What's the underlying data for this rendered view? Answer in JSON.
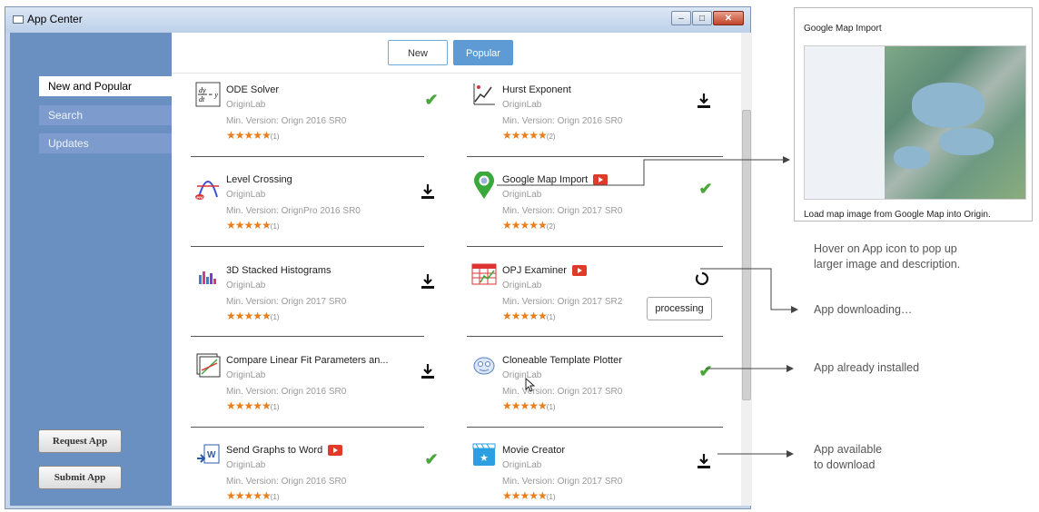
{
  "window": {
    "title": "App Center"
  },
  "sidebar": {
    "nav": [
      {
        "label": "New and Popular",
        "active": true
      },
      {
        "label": "Search",
        "active": false
      },
      {
        "label": "Updates",
        "active": false
      }
    ],
    "request_label": "Request App",
    "submit_label": "Submit App"
  },
  "tabs": {
    "new_label": "New",
    "popular_label": "Popular"
  },
  "apps": [
    {
      "name": "ODE Solver",
      "author": "OriginLab",
      "version": "Min. Version: Orign 2016 SR0",
      "stars": "★★★★★",
      "count": "(1)",
      "status": "installed",
      "icon": "ode-solver-icon"
    },
    {
      "name": "Hurst Exponent",
      "author": "OriginLab",
      "version": "Min. Version: Orign 2016 SR0",
      "stars": "★★★★★",
      "count": "(2)",
      "status": "download",
      "icon": "hurst-exponent-icon"
    },
    {
      "name": "Level Crossing",
      "author": "OriginLab",
      "version": "Min. Version: OrignPro 2016 SR0",
      "stars": "★★★★★",
      "count": "(1)",
      "status": "download",
      "icon": "level-crossing-icon"
    },
    {
      "name": "Google Map Import",
      "author": "OriginLab",
      "version": "Min. Version: Orign 2017 SR0",
      "stars": "★★★★★",
      "count": "(2)",
      "status": "installed",
      "icon": "map-pin-icon",
      "video": true
    },
    {
      "name": "3D Stacked Histograms",
      "author": "OriginLab",
      "version": "Min. Version: Orign 2017 SR0",
      "stars": "★★★★★",
      "count": "(1)",
      "status": "download",
      "icon": "histogram-icon"
    },
    {
      "name": "OPJ Examiner",
      "author": "OriginLab",
      "version": "Min. Version: Orign 2017 SR2",
      "stars": "★★★★★",
      "count": "(1)",
      "status": "processing",
      "icon": "spreadsheet-icon",
      "video": true
    },
    {
      "name": "Compare Linear Fit Parameters an...",
      "author": "OriginLab",
      "version": "Min. Version: Orign 2016 SR0",
      "stars": "★★★★★",
      "count": "(1)",
      "status": "download",
      "icon": "linear-fit-icon"
    },
    {
      "name": "Cloneable Template Plotter",
      "author": "OriginLab",
      "version": "Min. Version: Orign 2017 SR0",
      "stars": "★★★★★",
      "count": "(1)",
      "status": "installed",
      "icon": "template-plotter-icon"
    },
    {
      "name": "Send Graphs to Word",
      "author": "OriginLab",
      "version": "Min. Version: Orign 2016 SR0",
      "stars": "★★★★★",
      "count": "(1)",
      "status": "installed",
      "icon": "word-icon",
      "video": true
    },
    {
      "name": "Movie Creator",
      "author": "OriginLab",
      "version": "Min. Version: Orign 2017 SR0",
      "stars": "★★★★★",
      "count": "(1)",
      "status": "download",
      "icon": "movie-icon"
    }
  ],
  "processing_label": "processing",
  "preview": {
    "title": "Google Map Import",
    "description": "Load map image from Google Map into Origin."
  },
  "annotations": {
    "hover_line1": "Hover on App icon to pop up",
    "hover_line2": "larger image and description.",
    "downloading": "App downloading…",
    "installed": "App already installed",
    "available_line1": "App available",
    "available_line2": "to download"
  },
  "colors": {
    "sidebar": "#6a8fc1",
    "accent": "#5e9bd4",
    "stars": "#e87e1c",
    "check": "#4aa83a",
    "video": "#e03a2b"
  }
}
